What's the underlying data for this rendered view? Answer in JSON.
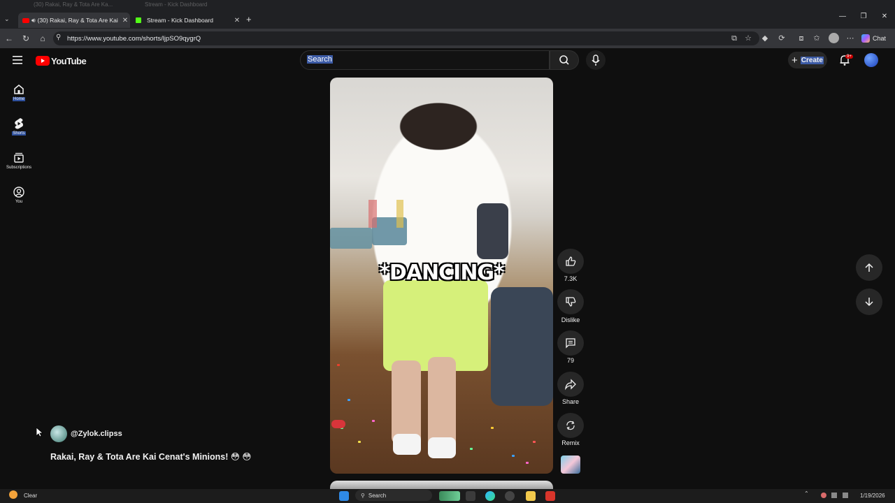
{
  "browser": {
    "ghost_tabs": [
      "(30) Rakai, Ray & Tota Are Ka...",
      "Stream - Kick Dashboard"
    ],
    "tabs": [
      {
        "title": "(30) Rakai, Ray & Tota Are Kai",
        "active": true
      },
      {
        "title": "Stream - Kick Dashboard",
        "active": false
      }
    ],
    "new_tab": "+",
    "url": "https://www.youtube.com/shorts/ljpSO9qygrQ",
    "chat_label": "Chat"
  },
  "youtube": {
    "logo_text": "YouTube",
    "sidebar": [
      {
        "label": "Home",
        "icon": "home-icon",
        "selected": true
      },
      {
        "label": "Shorts",
        "icon": "shorts-icon",
        "selected": true
      },
      {
        "label": "Subscriptions",
        "icon": "subscriptions-icon",
        "selected": false
      },
      {
        "label": "You",
        "icon": "you-icon",
        "selected": false
      }
    ],
    "search": {
      "text": "Search"
    },
    "create_label": "Create",
    "notification_count": "9+",
    "video": {
      "caption": "*DANCING*"
    },
    "actions": {
      "like_count": "7.3K",
      "dislike_label": "Dislike",
      "comment_count": "79",
      "share_label": "Share",
      "remix_label": "Remix"
    },
    "channel": "@Zylok.clipss",
    "title": "Rakai, Ray & Tota Are Kai Cenat's Minions! 😳 😳"
  },
  "taskbar": {
    "weather": "Clear",
    "search_label": "Search",
    "date": "1/19/2026"
  },
  "colors": {
    "background": "#0f0f0f",
    "accent_red": "#ff0000",
    "selection_blue": "#3c5ba6"
  }
}
